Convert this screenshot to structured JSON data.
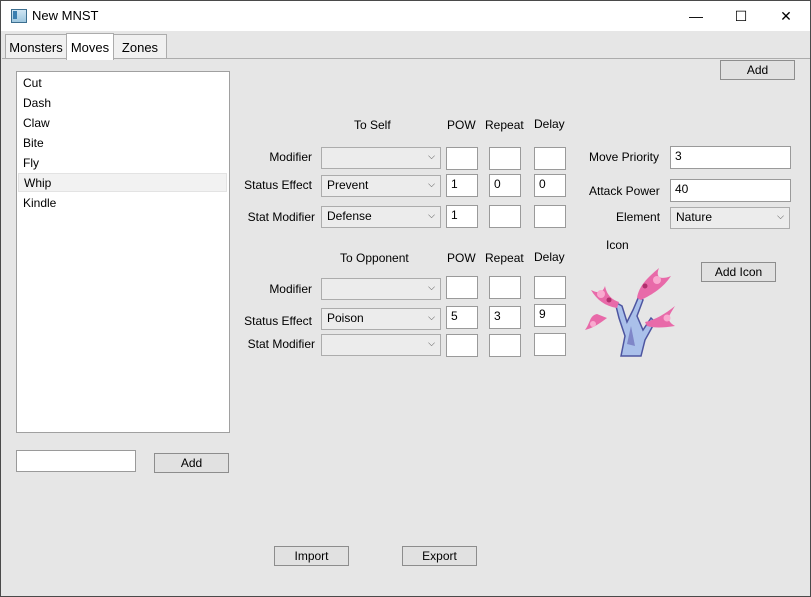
{
  "window": {
    "title": "New MNST",
    "minimize": "—",
    "maximize": "☐",
    "close": "✕"
  },
  "tabs": [
    {
      "label": "Monsters"
    },
    {
      "label": "Moves"
    },
    {
      "label": "Zones"
    }
  ],
  "top_add_button": "Add",
  "moves_list": [
    "Cut",
    "Dash",
    "Claw",
    "Bite",
    "Fly",
    "Whip",
    "Kindle"
  ],
  "selected_move": "Whip",
  "new_move": {
    "value": "",
    "add_label": "Add"
  },
  "headers": {
    "to_self": "To Self",
    "to_opponent": "To Opponent",
    "pow": "POW",
    "repeat": "Repeat",
    "delay": "Delay"
  },
  "row_labels": {
    "modifier": "Modifier",
    "status_effect": "Status Effect",
    "stat_modifier": "Stat Modifier"
  },
  "self": {
    "modifier": {
      "select": "",
      "pow": "",
      "repeat": "",
      "delay": ""
    },
    "status_effect": {
      "select": "Prevent",
      "pow": "1",
      "repeat": "0",
      "delay": "0"
    },
    "stat_modifier": {
      "select": "Defense",
      "pow": "1",
      "repeat": "",
      "delay": ""
    }
  },
  "opponent": {
    "modifier": {
      "select": "",
      "pow": "",
      "repeat": "",
      "delay": ""
    },
    "status_effect": {
      "select": "Poison",
      "pow": "5",
      "repeat": "3",
      "delay": "9"
    },
    "stat_modifier": {
      "select": "",
      "pow": "",
      "repeat": "",
      "delay": ""
    }
  },
  "properties": {
    "move_priority_label": "Move Priority",
    "move_priority": "3",
    "attack_power_label": "Attack Power",
    "attack_power": "40",
    "element_label": "Element",
    "element": "Nature",
    "icon_label": "Icon",
    "add_icon": "Add Icon"
  },
  "bottom": {
    "import": "Import",
    "export": "Export"
  },
  "icons": {
    "dropdown": "chevron-down-icon",
    "app": "app-icon",
    "tree": "tree-sprite-icon"
  }
}
